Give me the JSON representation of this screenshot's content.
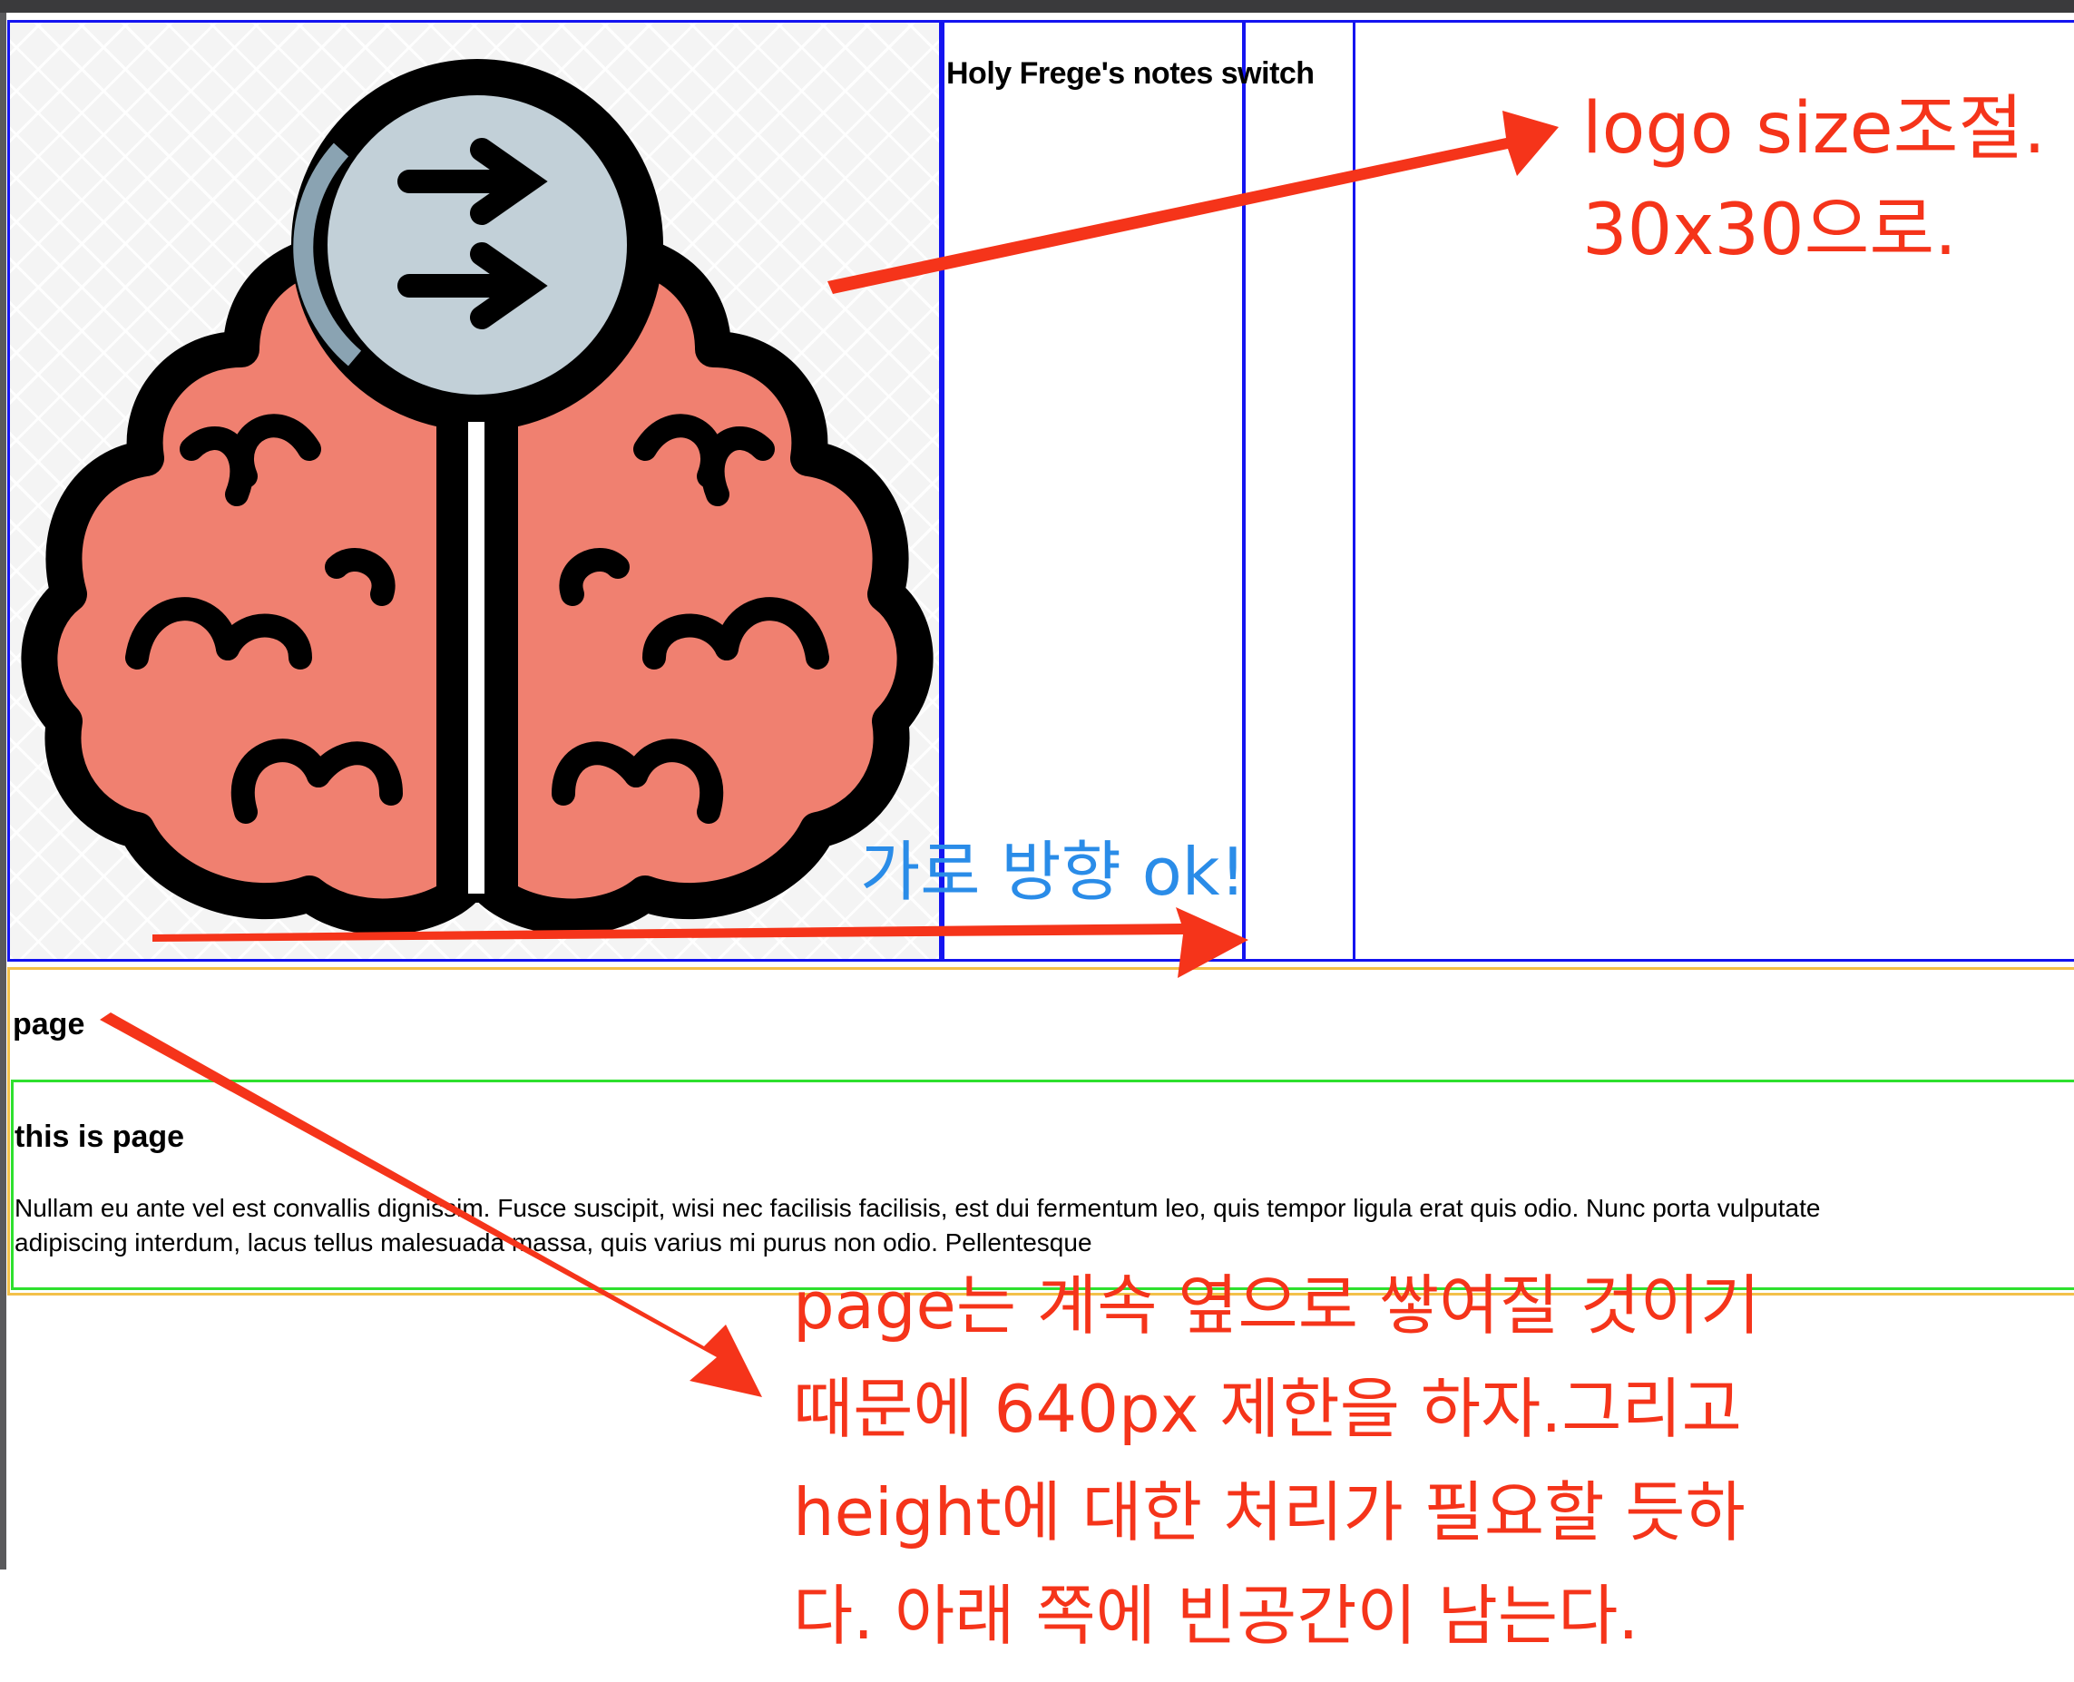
{
  "header": {
    "app_title": "Holy Frege's notes switch"
  },
  "page_section": {
    "heading": "page",
    "inner_title": "this is page",
    "body_line_1": "Nullam eu ante vel est convallis dignissim. Fusce suscipit, wisi nec facilisis facilisis, est dui fermentum leo, quis tempor ligula erat quis odio. Nunc porta vulputate",
    "body_line_2": "adipiscing interdum, lacus tellus malesuada massa, quis varius mi purus non odio. Pellentesque"
  },
  "annotations": {
    "logo_note_line_1": "logo size조절.",
    "logo_note_line_2": "30x30으로.",
    "horizontal_note": "가로 방향 ok!",
    "page_note_line_1": "page는 계속 옆으로 쌓여질 것이기",
    "page_note_line_2": "때문에 640px 제한을 하자.그리고",
    "page_note_line_3": "height에 대한 처리가 필요할 듯하",
    "page_note_line_4": "다. 아래 쪽에 빈공간이 남는다."
  },
  "colors": {
    "box_outline": "#1414f0",
    "page_outline": "#f3c14a",
    "inner_outline": "#2ee02e",
    "note_red": "#f5341a",
    "note_blue": "#2a8ce8",
    "brain_fill": "#f08070",
    "bulb_fill": "#c2d0d8"
  },
  "icons": {
    "logo": "brain-lightbulb-arrows-logo"
  }
}
